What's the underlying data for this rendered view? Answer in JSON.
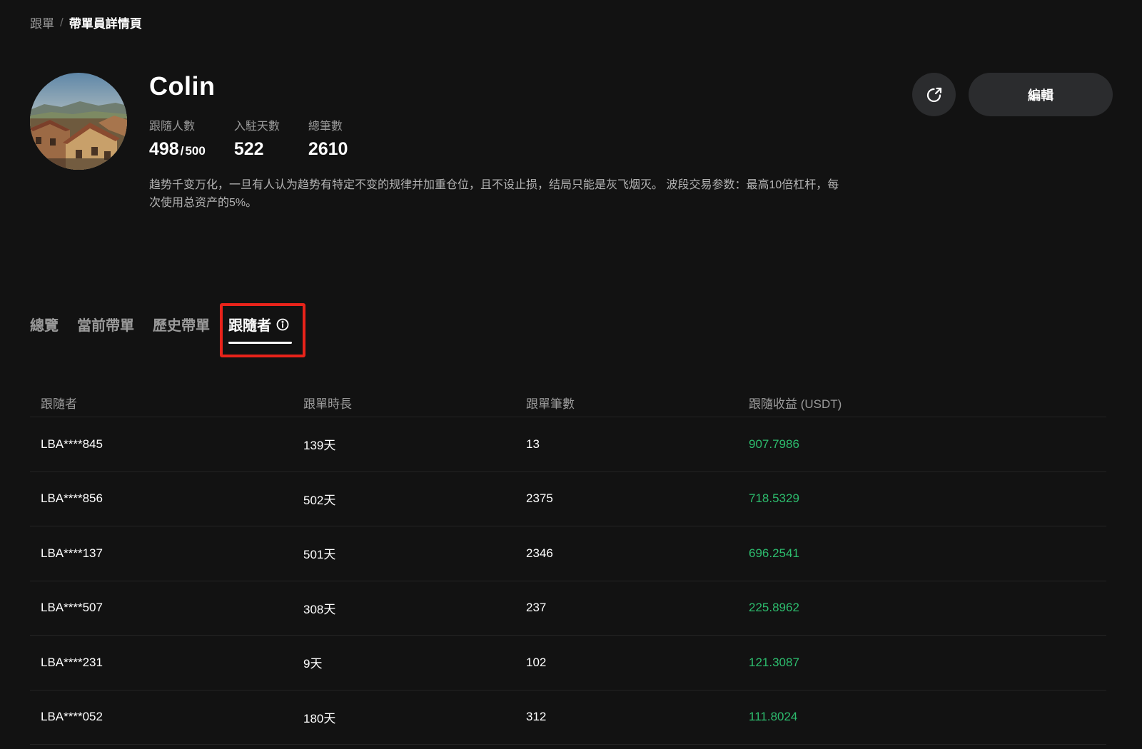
{
  "breadcrumb": {
    "parent": "跟單",
    "separator": "/",
    "current": "帶單員詳情頁"
  },
  "profile": {
    "name": "Colin",
    "stats": {
      "followers_label": "跟隨人數",
      "followers_value": "498",
      "followers_max": "500",
      "days_label": "入駐天數",
      "days_value": "522",
      "trades_label": "總筆數",
      "trades_value": "2610"
    },
    "bio": "趋势千变万化，一旦有人认为趋势有特定不变的规律并加重仓位，且不设止损，结局只能是灰飞烟灭。 波段交易参数：最高10倍杠杆，每次使用总资产的5%。"
  },
  "actions": {
    "share_icon": "share-icon",
    "edit_label": "編輯"
  },
  "tabs": [
    {
      "label": "總覽"
    },
    {
      "label": "當前帶單"
    },
    {
      "label": "歷史帶單"
    },
    {
      "label": "跟隨者",
      "active": true,
      "icon": "info-icon"
    }
  ],
  "table": {
    "headers": [
      "跟隨者",
      "跟單時長",
      "跟單筆數",
      "跟隨收益 (USDT)"
    ],
    "rows": [
      {
        "follower": "LBA****845",
        "duration": "139天",
        "count": "13",
        "profit": "907.7986"
      },
      {
        "follower": "LBA****856",
        "duration": "502天",
        "count": "2375",
        "profit": "718.5329"
      },
      {
        "follower": "LBA****137",
        "duration": "501天",
        "count": "2346",
        "profit": "696.2541"
      },
      {
        "follower": "LBA****507",
        "duration": "308天",
        "count": "237",
        "profit": "225.8962"
      },
      {
        "follower": "LBA****231",
        "duration": "9天",
        "count": "102",
        "profit": "121.3087"
      },
      {
        "follower": "LBA****052",
        "duration": "180天",
        "count": "312",
        "profit": "111.8024"
      }
    ]
  },
  "colors": {
    "background": "#121212",
    "profit_green": "#2dbd6e",
    "highlight_red": "#e8231a",
    "button_bg": "#2b2c2e"
  }
}
